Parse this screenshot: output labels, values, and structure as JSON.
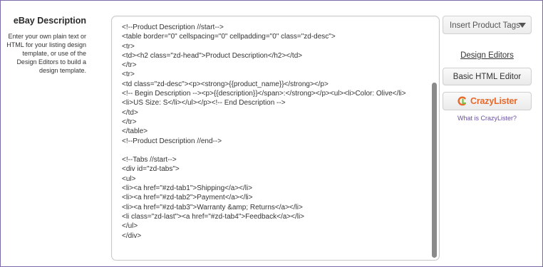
{
  "section": {
    "title": "eBay Description",
    "help_text": "Enter your own plain text or HTML for your listing design template, or use of the Design Editors to build a design template."
  },
  "editor": {
    "content": "<!--Product Description //start-->\n<table border=\"0\" cellspacing=\"0\" cellpadding=\"0\" class=\"zd-desc\">\n<tr>\n<td><h2 class=\"zd-head\">Product Description</h2></td>\n</tr>\n<tr>\n<td class=\"zd-desc\"><p><strong>{{product_name}}</strong></p>\n<!-- Begin Description --><p>{{description}}</span>:</strong></p><ul><li>Color: Olive</li><li>US Size: S</li></ul></p><!-- End Description -->\n</td>\n</tr>\n</table>\n<!--Product Description //end-->\n\n<!--Tabs //start-->\n<div id=\"zd-tabs\">\n<ul>\n<li><a href=\"#zd-tab1\">Shipping</a></li>\n<li><a href=\"#zd-tab2\">Payment</a></li>\n<li><a href=\"#zd-tab3\">Warranty &amp; Returns</a></li>\n<li class=\"zd-last\"><a href=\"#zd-tab4\">Feedback</a></li>\n</ul>\n</div>"
  },
  "sidebar": {
    "insert_tags_label": "Insert Product Tags",
    "design_editors_label": "Design Editors",
    "basic_html_editor_label": "Basic HTML Editor",
    "crazylister_label": "CrazyLister",
    "what_is_crazylister_label": "What is CrazyLister?"
  },
  "colors": {
    "frame_border": "#7d6aa8",
    "crazylister_orange": "#e8692a",
    "crazylister_green": "#7cc242",
    "link_purple": "#6a4fa6"
  },
  "icons": {
    "insert_tags_caret": "chevron-down-icon",
    "crazylister_logo": "crazylister-logo-icon"
  }
}
